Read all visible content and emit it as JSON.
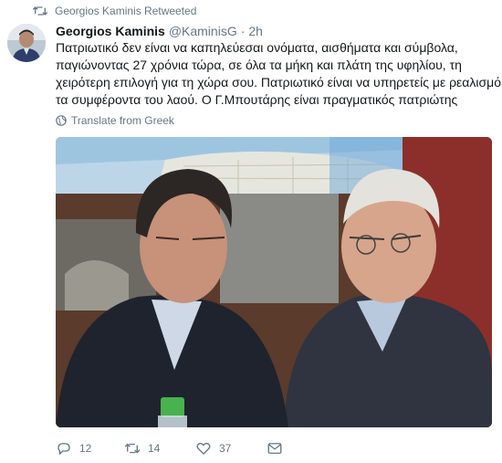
{
  "retweet_context": {
    "text": "Georgios Kaminis Retweeted",
    "icon": "retweet-icon"
  },
  "tweet": {
    "author_name": "Georgios Kaminis",
    "author_handle": "@KaminisG",
    "separator": "·",
    "timestamp": "2h",
    "text_lines": [
      "Πατριωτικό δεν είναι να καπηλεύεσαι ονόματα, αισθήματα και σύμβολα,",
      "παγιώνοντας 27 χρόνια τώρα, σε όλα τα μήκη και πλάτη της υφηλίου, τη",
      "χειρότερη επιλογή για τη χώρα σου. Πατριωτικό είναι να υπηρετείς με ρεαλισμό",
      "τα συμφέροντα του λαού. Ο Γ.Μπουτάρης είναι πραγματικός πατριώτης"
    ],
    "translate_label": "Translate from Greek",
    "media": {
      "type": "photo",
      "icon": "photo-image"
    }
  },
  "actions": {
    "reply": {
      "count": "12",
      "icon": "reply-icon"
    },
    "retweet": {
      "count": "14",
      "icon": "retweet-icon"
    },
    "like": {
      "count": "37",
      "icon": "heart-icon"
    },
    "dm": {
      "icon": "envelope-icon"
    }
  },
  "colors": {
    "text": "#14171a",
    "muted": "#657786",
    "background": "#ffffff"
  }
}
